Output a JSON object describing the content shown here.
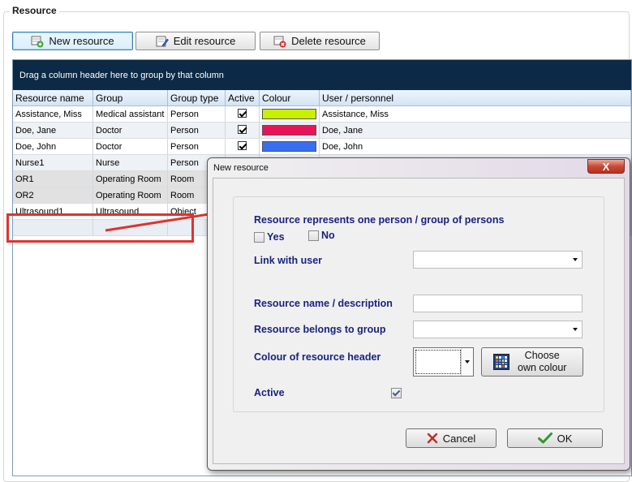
{
  "group": {
    "title": "Resource"
  },
  "toolbar": {
    "new_label": "New resource",
    "edit_label": "Edit resource",
    "delete_label": "Delete resource"
  },
  "grid": {
    "group_hint": "Drag a column header here to group by that column",
    "columns": [
      "Resource name",
      "Group",
      "Group type",
      "Active",
      "Colour",
      "User / personnel"
    ],
    "rows": [
      {
        "name": "Assistance, Miss",
        "group": "Medical assistant",
        "type": "Person",
        "active": true,
        "colour": "#c8f000",
        "user": "Assistance, Miss"
      },
      {
        "name": "Doe, Jane",
        "group": "Doctor",
        "type": "Person",
        "active": true,
        "colour": "#e8145a",
        "user": "Doe, Jane"
      },
      {
        "name": "Doe, John",
        "group": "Doctor",
        "type": "Person",
        "active": true,
        "colour": "#3a6ef0",
        "user": "Doe, John"
      },
      {
        "name": "Nurse1",
        "group": "Nurse",
        "type": "Person",
        "active": true,
        "colour": "#8a4fb0",
        "user": ""
      },
      {
        "name": "OR1",
        "group": "Operating Room",
        "type": "Room",
        "active": true,
        "colour": "#c8a030",
        "user": ""
      },
      {
        "name": "OR2",
        "group": "Operating Room",
        "type": "Room",
        "active": true,
        "colour": "#40a060",
        "user": ""
      },
      {
        "name": "Ultrasound1",
        "group": "Ultrasound",
        "type": "Object",
        "active": true,
        "colour": "#d06040",
        "user": ""
      }
    ]
  },
  "dialog": {
    "title": "New resource",
    "close_label": "X",
    "represents_label": "Resource represents one person / group of persons",
    "yes_label": "Yes",
    "no_label": "No",
    "yes_checked": false,
    "no_checked": false,
    "link_user_label": "Link with user",
    "link_user_value": "",
    "name_label": "Resource name / description",
    "name_value": "",
    "group_label": "Resource belongs to group",
    "group_value": "",
    "colour_label": "Colour of resource header",
    "colour_value": "#ffffff",
    "own_colour_line1": "Choose",
    "own_colour_line2": "own colour",
    "active_label": "Active",
    "active_checked": true,
    "cancel_label": "Cancel",
    "ok_label": "OK"
  },
  "colors": {
    "annotation": "#e0322e",
    "label_text": "#1a237e",
    "group_panel": "#0c2a45"
  }
}
